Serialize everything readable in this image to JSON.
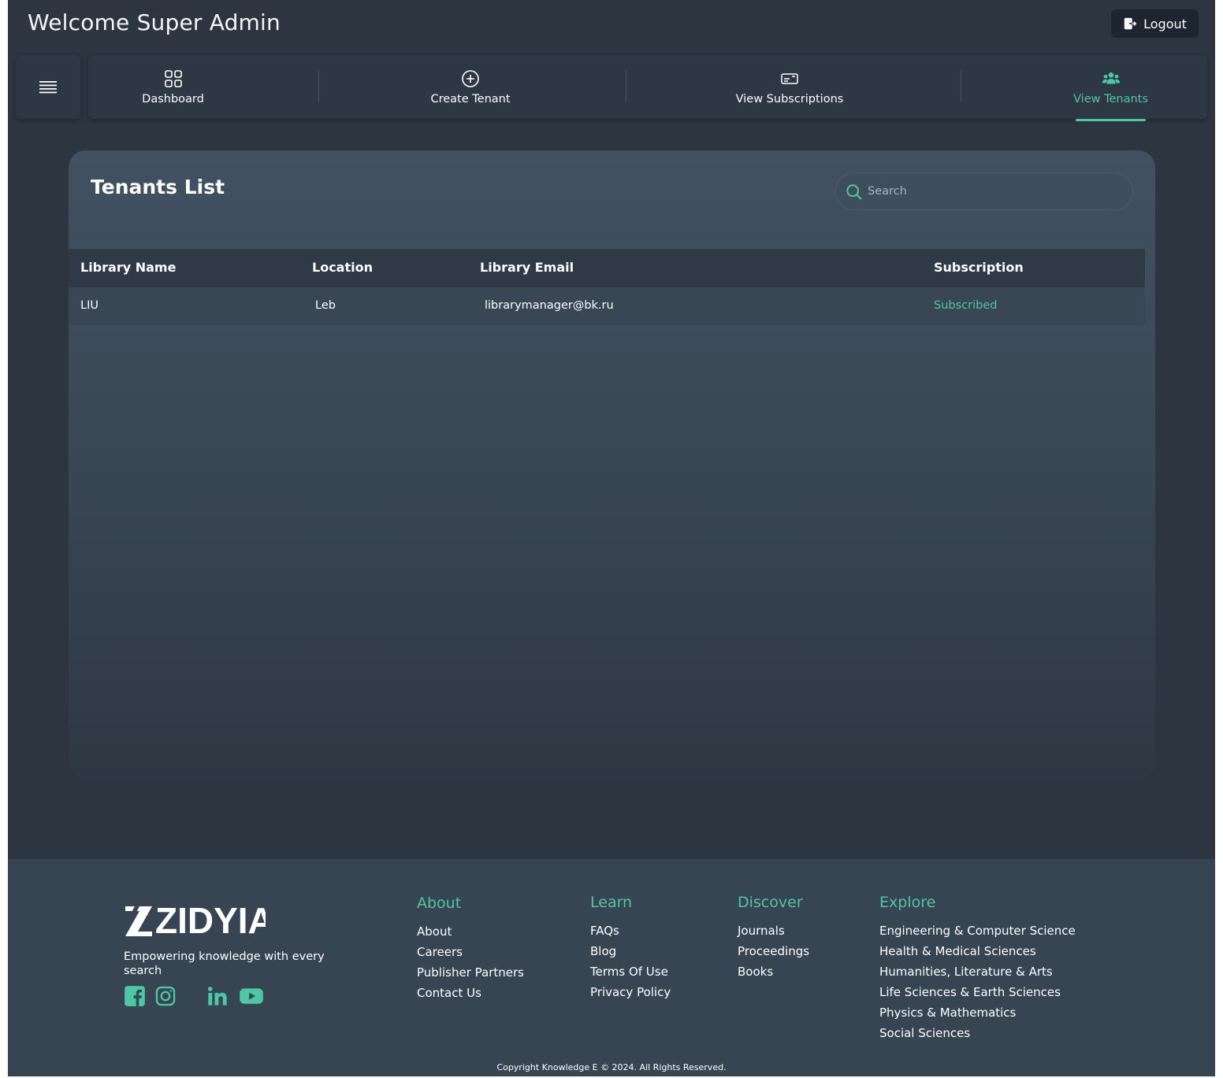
{
  "header": {
    "welcome": "Welcome Super Admin",
    "logout_label": "Logout"
  },
  "nav": {
    "items": [
      {
        "label": "Dashboard",
        "icon": "dashboard-grid-icon"
      },
      {
        "label": "Create Tenant",
        "icon": "plus-circle-icon"
      },
      {
        "label": "View Subscriptions",
        "icon": "card-icon"
      },
      {
        "label": "View Tenants",
        "icon": "users-icon",
        "active": true
      }
    ]
  },
  "tenants": {
    "title": "Tenants List",
    "search_placeholder": "Search",
    "columns": [
      "Library Name",
      "Location",
      "Library Email",
      "Subscription"
    ],
    "rows": [
      {
        "library_name": "LIU",
        "location": "Leb",
        "email": "librarymanager@bk.ru",
        "subscription": "Subscribed"
      }
    ]
  },
  "footer": {
    "brand": "ZIDYIA",
    "tagline": "Empowering knowledge with every search",
    "social": [
      "facebook-icon",
      "instagram-icon",
      "linkedin-icon",
      "youtube-icon"
    ],
    "columns": [
      {
        "title": "About",
        "links": [
          "About",
          "Careers",
          "Publisher Partners",
          "Contact Us"
        ]
      },
      {
        "title": "Learn",
        "links": [
          "FAQs",
          "Blog",
          "Terms Of Use",
          "Privacy Policy"
        ]
      },
      {
        "title": "Discover",
        "links": [
          "Journals",
          "Proceedings",
          "Books"
        ]
      },
      {
        "title": "Explore",
        "links": [
          "Engineering & Computer Science",
          "Health & Medical Sciences",
          "Humanities, Literature & Arts",
          "Life Sciences & Earth Sciences",
          "Physics & Mathematics",
          "Social Sciences"
        ]
      }
    ],
    "copyright": "Copyright Knowledge E © 2024. All Rights Reserved."
  },
  "colors": {
    "accent": "#4cc9a3",
    "background": "#2c3540",
    "footer": "#374451"
  }
}
